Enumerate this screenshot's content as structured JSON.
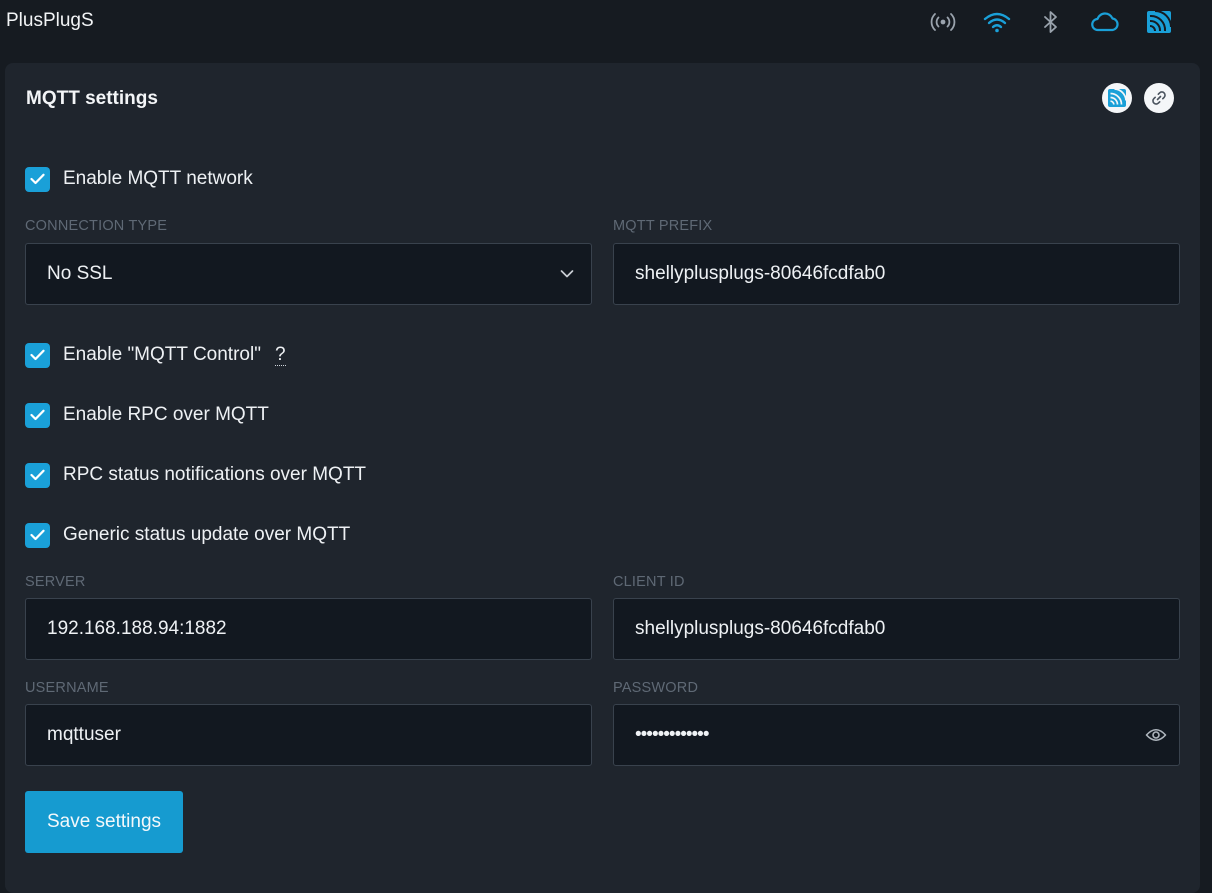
{
  "header": {
    "title": "PlusPlugS",
    "status_icons": [
      {
        "name": "ap-signal-icon",
        "color": "#9aa3ad"
      },
      {
        "name": "wifi-icon",
        "color": "#1aa0d8"
      },
      {
        "name": "bluetooth-icon",
        "color": "#9aa3ad"
      },
      {
        "name": "cloud-icon",
        "color": "#1aa0d8"
      },
      {
        "name": "mqtt-icon",
        "color": "#1aa0d8"
      }
    ]
  },
  "card": {
    "title": "MQTT settings",
    "actions": [
      "mqtt-icon",
      "link-icon"
    ]
  },
  "checkboxes": {
    "enable_mqtt": {
      "label": "Enable MQTT network",
      "checked": true
    },
    "mqtt_control": {
      "label": "Enable \"MQTT Control\"",
      "checked": true,
      "help": "?"
    },
    "rpc_over_mqtt": {
      "label": "Enable RPC over MQTT",
      "checked": true
    },
    "rpc_status": {
      "label": "RPC status notifications over MQTT",
      "checked": true
    },
    "generic_status": {
      "label": "Generic status update over MQTT",
      "checked": true
    }
  },
  "fields": {
    "connection_type": {
      "label": "CONNECTION TYPE",
      "value": "No SSL"
    },
    "mqtt_prefix": {
      "label": "MQTT PREFIX",
      "value": "shellyplusplugs-80646fcdfab0"
    },
    "server": {
      "label": "SERVER",
      "value": "192.168.188.94:1882"
    },
    "client_id": {
      "label": "CLIENT ID",
      "value": "shellyplusplugs-80646fcdfab0"
    },
    "username": {
      "label": "USERNAME",
      "value": "mqttuser"
    },
    "password": {
      "label": "PASSWORD",
      "value": "•••••••••••••"
    }
  },
  "save_button": {
    "label": "Save settings"
  },
  "colors": {
    "accent": "#1aa0d8",
    "background": "#161b21",
    "card": "#1f252d",
    "input": "#121820"
  }
}
